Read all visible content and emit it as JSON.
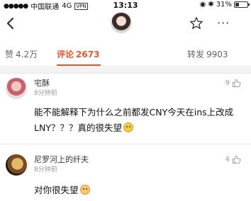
{
  "status_bar": {
    "carrier": "中国联通",
    "network": "4G",
    "vpn": "VPN",
    "time": "13:13",
    "battery": "31%",
    "battery_level": 0.31
  },
  "nav": {
    "back_icon": "chevron-left-icon",
    "star_icon": "star-outline-icon",
    "more_icon": "more-dots-icon",
    "more_label": "···"
  },
  "tabs": {
    "likes": {
      "label": "赞",
      "count": "4.2万"
    },
    "comments": {
      "label": "评论",
      "count": "2673"
    },
    "reposts": {
      "label": "转发",
      "count": "9903"
    }
  },
  "comments": [
    {
      "name": "宅酥",
      "time": "8分钟前",
      "likes": "9",
      "text": "能不能解释下为什么之前都发CNY今天在ins上改成LNY？？？真的很失望",
      "emoji": "smile-emoji"
    },
    {
      "name": "尼罗河上的纤夫",
      "time": "8分钟前",
      "likes": "4",
      "text": "对你很失望",
      "emoji": "sad-emoji"
    }
  ],
  "colors": {
    "accent": "#e8572e",
    "muted": "#999999"
  }
}
